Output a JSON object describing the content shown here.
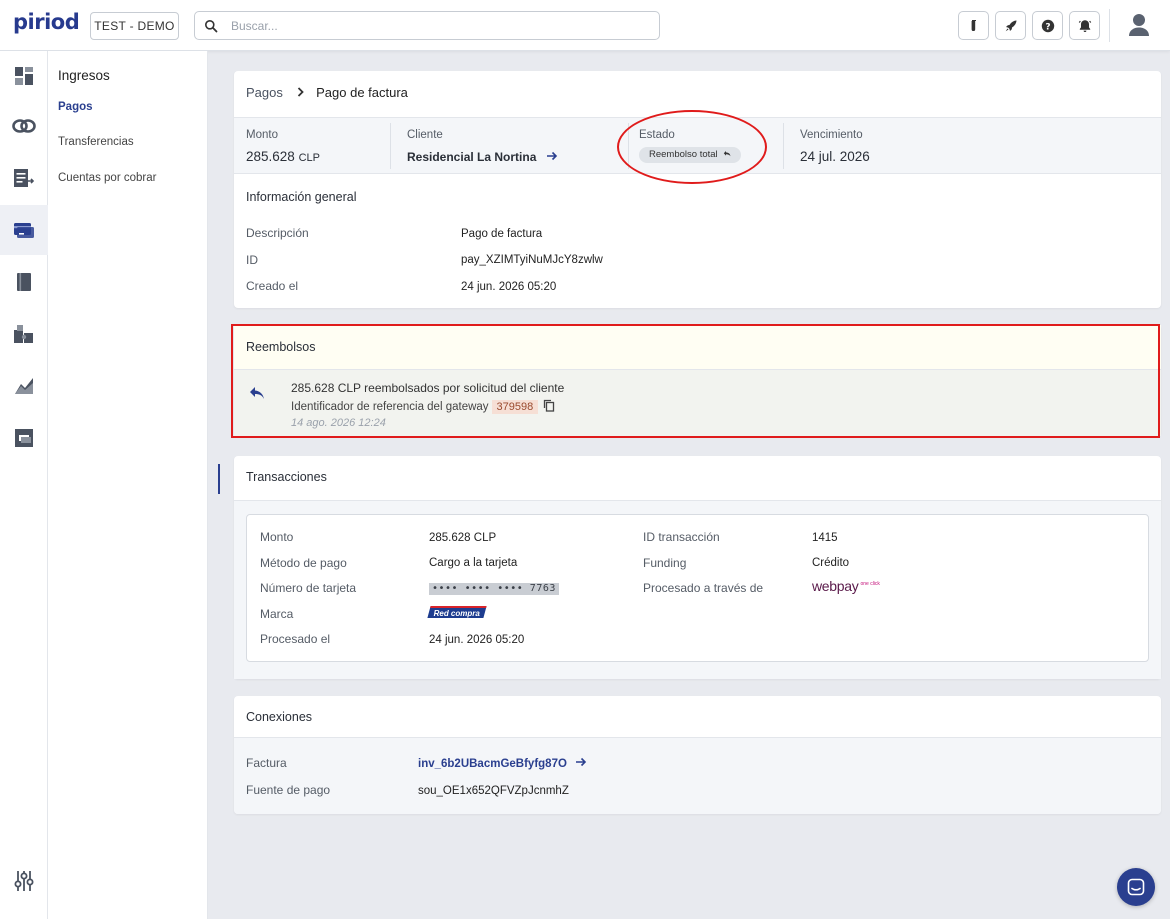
{
  "app": {
    "logo": "piriod",
    "environment": "TEST - DEMO"
  },
  "search": {
    "placeholder": "Buscar..."
  },
  "subnav": {
    "heading": "Ingresos",
    "items": [
      {
        "label": "Pagos",
        "active": true
      },
      {
        "label": "Transferencias",
        "active": false
      },
      {
        "label": "Cuentas por cobrar",
        "active": false
      }
    ]
  },
  "breadcrumb": {
    "parent": "Pagos",
    "current": "Pago de factura"
  },
  "summary": {
    "amount_label": "Monto",
    "amount_value": "285.628",
    "amount_currency": "CLP",
    "client_label": "Cliente",
    "client_value": "Residencial La Nortina",
    "status_label": "Estado",
    "status_value": "Reembolso total",
    "due_label": "Vencimiento",
    "due_value": "24 jul. 2026"
  },
  "general": {
    "title": "Información general",
    "rows": [
      {
        "label": "Descripción",
        "value": "Pago de factura"
      },
      {
        "label": "ID",
        "value": "pay_XZIMTyiNuMJcY8zwlw"
      },
      {
        "label": "Creado el",
        "value": "24 jun. 2026 05:20"
      }
    ]
  },
  "refunds": {
    "title": "Reembolsos",
    "message": "285.628 CLP reembolsados por solicitud del cliente",
    "reference_label": "Identificador de referencia del gateway",
    "reference_value": "379598",
    "timestamp": "14 ago. 2026 12:24"
  },
  "transactions": {
    "title": "Transacciones",
    "left": [
      {
        "label": "Monto",
        "value": "285.628 CLP"
      },
      {
        "label": "Método de pago",
        "value": "Cargo a la tarjeta"
      },
      {
        "label": "Número de tarjeta",
        "value": "•••• •••• •••• 7763"
      },
      {
        "label": "Marca",
        "value": "Red compra"
      },
      {
        "label": "Procesado el",
        "value": "24 jun. 2026 05:20"
      }
    ],
    "right": [
      {
        "label": "ID transacción",
        "value": "1415"
      },
      {
        "label": "Funding",
        "value": "Crédito"
      },
      {
        "label": "Procesado a través de",
        "value": "webpay",
        "logo_suffix": "one click"
      }
    ]
  },
  "connections": {
    "title": "Conexiones",
    "rows": [
      {
        "label": "Factura",
        "value": "inv_6b2UBacmGeBfyfg87O"
      },
      {
        "label": "Fuente de pago",
        "value": "sou_OE1x652QFVZpJcnmhZ"
      }
    ]
  },
  "colors": {
    "brand": "#2a3f8f",
    "annotation": "#e01b1b",
    "background": "#e8eaef"
  },
  "icons": {
    "rail": [
      "dashboard-icon",
      "link-icon",
      "invoice-icon",
      "payments-card-icon",
      "book-icon",
      "puzzle-icon",
      "chart-area-icon",
      "layers-icon",
      "settings-sliders-icon"
    ],
    "topbar": [
      "flask-icon",
      "rocket-icon",
      "help-icon",
      "bell-icon",
      "user-icon"
    ]
  }
}
